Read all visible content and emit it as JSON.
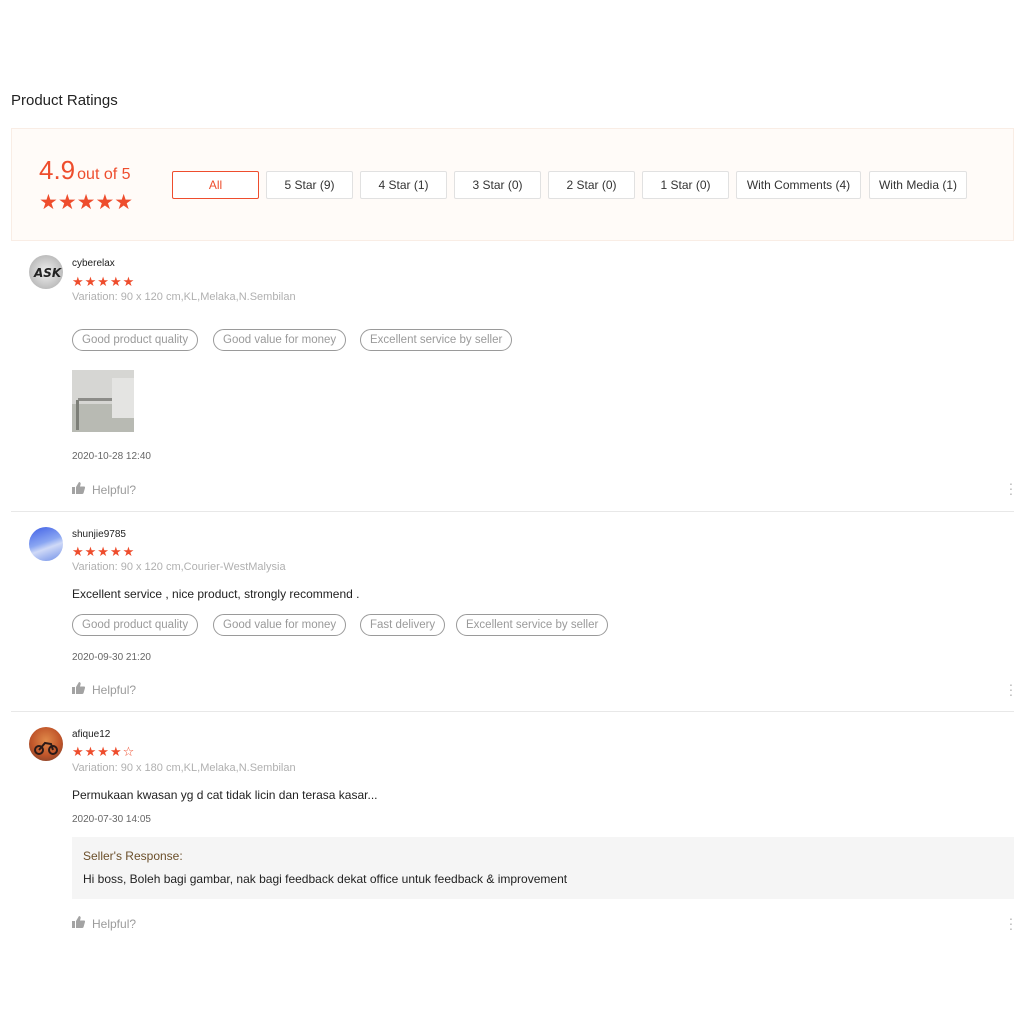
{
  "section_title": "Product Ratings",
  "overview": {
    "score": "4.9",
    "score_suffix": "out of 5",
    "stars_display": "★★★★★",
    "filters": [
      {
        "label": "All",
        "active": true
      },
      {
        "label": "5 Star (9)",
        "active": false
      },
      {
        "label": "4 Star (1)",
        "active": false
      },
      {
        "label": "3 Star (0)",
        "active": false
      },
      {
        "label": "2 Star (0)",
        "active": false
      },
      {
        "label": "1 Star (0)",
        "active": false
      },
      {
        "label": "With Comments (4)",
        "active": false
      },
      {
        "label": "With Media (1)",
        "active": false
      }
    ]
  },
  "reviews": [
    {
      "username": "cyberelax",
      "rating": 5,
      "stars_display": "★★★★★",
      "variation": "Variation: 90 x 120 cm,KL,Melaka,N.Sembilan",
      "tags": [
        "Good product quality",
        "Good value for money",
        "Excellent service by seller"
      ],
      "has_media": true,
      "timestamp": "2020-10-28 12:40",
      "helpful_label": "Helpful?",
      "avatar_text": "ASK"
    },
    {
      "username": "shunjie9785",
      "rating": 5,
      "stars_display": "★★★★★",
      "variation": "Variation: 90 x 120 cm,Courier-WestMalysia",
      "comment": "Excellent service , nice product, strongly recommend .",
      "tags": [
        "Good product quality",
        "Good value for money",
        "Fast delivery",
        "Excellent service by seller"
      ],
      "timestamp": "2020-09-30 21:20",
      "helpful_label": "Helpful?"
    },
    {
      "username": "afique12",
      "rating": 4,
      "stars_display": "★★★★☆",
      "variation": "Variation: 90 x 180 cm,KL,Melaka,N.Sembilan",
      "comment": "Permukaan kwasan yg d cat tidak licin dan terasa kasar...",
      "timestamp": "2020-07-30 14:05",
      "seller_response": {
        "title": "Seller's Response:",
        "text": "Hi boss, Boleh bagi gambar, nak bagi feedback dekat office untuk feedback & improvement"
      },
      "helpful_label": "Helpful?"
    }
  ],
  "colors": {
    "accent": "#ee4d2d",
    "overview_bg": "#fffbf8",
    "tag_border": "#9a9a9a",
    "seller_bg": "#f5f5f5"
  }
}
